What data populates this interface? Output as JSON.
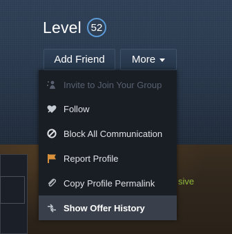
{
  "profile": {
    "level_label": "Level",
    "level_value": "52"
  },
  "buttons": {
    "add_friend": "Add Friend",
    "more": "More"
  },
  "menu": {
    "items": [
      {
        "label": "Invite to Join Your Group",
        "icon": "invite-icon",
        "disabled": true
      },
      {
        "label": "Follow",
        "icon": "follow-heart-icon"
      },
      {
        "label": "Block All Communication",
        "icon": "block-icon"
      },
      {
        "label": "Report Profile",
        "icon": "flag-icon"
      },
      {
        "label": "Copy Profile Permalink",
        "icon": "paperclip-icon"
      },
      {
        "label": "Show Offer History",
        "icon": "trade-arrows-icon",
        "highlighted": true
      }
    ]
  },
  "background": {
    "partial_text": "sive"
  },
  "colors": {
    "badge_ring": "#5c9bd8",
    "menu_bg": "#191d24",
    "menu_highlight": "#3a404b",
    "report_flag": "#d8913a",
    "olive_text": "#90ba3c"
  }
}
